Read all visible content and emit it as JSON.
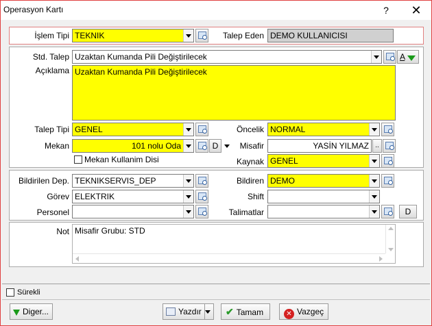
{
  "window": {
    "title": "Operasyon Kartı",
    "help": "?",
    "close": "✕"
  },
  "top": {
    "islem_tipi_label": "İşlem Tipi",
    "islem_tipi_value": "TEKNIK",
    "talep_eden_label": "Talep Eden",
    "talep_eden_value": "DEMO KULLANICISI"
  },
  "request": {
    "std_talep_label": "Std. Talep",
    "std_talep_value": "Uzaktan Kumanda Pili Değiştirilecek",
    "font_button": "A",
    "aciklama_label": "Açıklama",
    "aciklama_value": "Uzaktan Kumanda Pili Değiştirilecek",
    "talep_tipi_label": "Talep Tipi",
    "talep_tipi_value": "GENEL",
    "oncelik_label": "Öncelik",
    "oncelik_value": "NORMAL",
    "mekan_label": "Mekan",
    "mekan_value": "101 nolu Oda",
    "mekan_d_button": "D",
    "misafir_label": "Misafir",
    "misafir_value": "YASİN YILMAZ",
    "misafir_more": "..",
    "mekan_kullanim_label": "Mekan Kullanim Disi",
    "kaynak_label": "Kaynak",
    "kaynak_value": "GENEL"
  },
  "assign": {
    "bildirilen_dep_label": "Bildirilen Dep.",
    "bildirilen_dep_value": "TEKNIKSERVIS_DEP",
    "bildiren_label": "Bildiren",
    "bildiren_value": "DEMO",
    "gorev_label": "Görev",
    "gorev_value": "ELEKTRIK",
    "shift_label": "Shift",
    "shift_value": "",
    "personel_label": "Personel",
    "personel_value": "",
    "talimatlar_label": "Talimatlar",
    "talimatlar_value": "",
    "d_button": "D"
  },
  "note": {
    "label": "Not",
    "value": "Misafir Grubu: STD"
  },
  "footer": {
    "surekli_label": "Sürekli",
    "diger": "Diger...",
    "yazdir": "Yazdır",
    "tamam": "Tamam",
    "vazgec": "Vazgeç"
  }
}
